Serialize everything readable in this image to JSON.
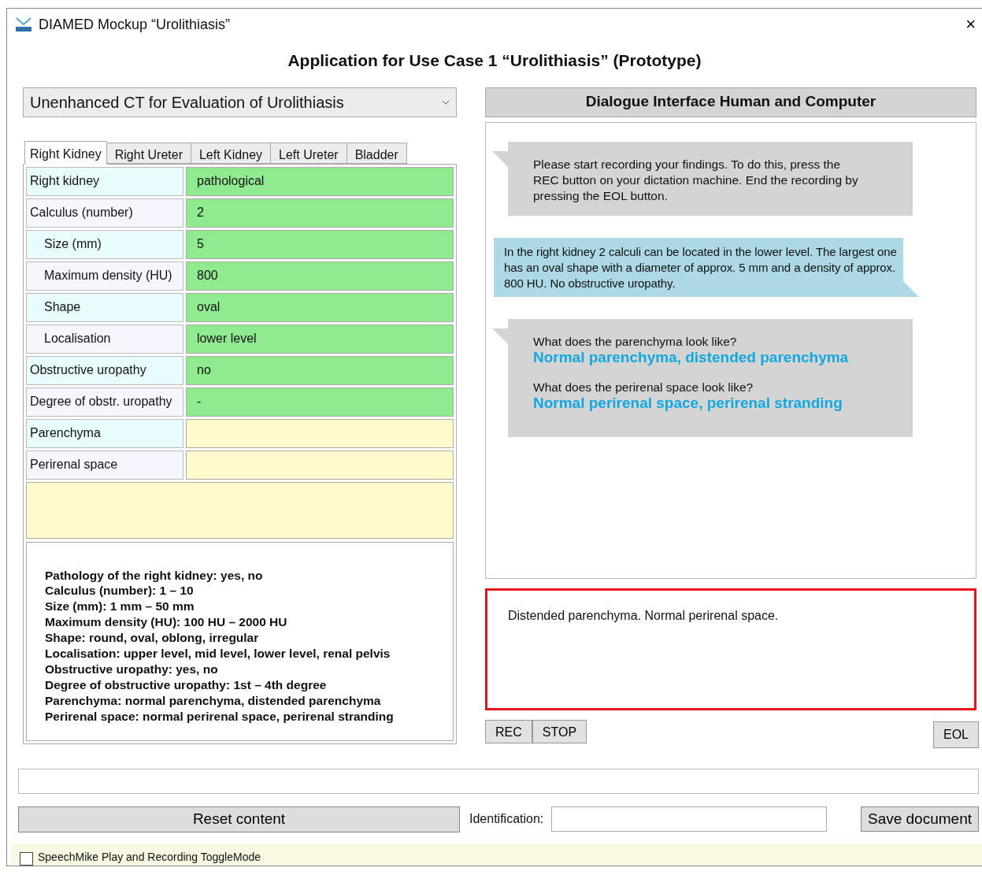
{
  "window": {
    "title": "DIAMED Mockup “Urolithiasis”",
    "close": "×"
  },
  "heading": "Application for Use Case 1 “Urolithiasis” (Prototype)",
  "protocol_select": {
    "value": "Unenhanced CT for Evaluation of Urolithiasis"
  },
  "tabs": [
    {
      "label": "Right Kidney",
      "selected": true
    },
    {
      "label": "Right Ureter",
      "selected": false
    },
    {
      "label": "Left Kidney",
      "selected": false
    },
    {
      "label": "Left Ureter",
      "selected": false
    },
    {
      "label": "Bladder",
      "selected": false
    }
  ],
  "findings": [
    {
      "label": "Right kidney",
      "value": "pathological",
      "indent": false,
      "filled": true
    },
    {
      "label": "Calculus (number)",
      "value": "2",
      "indent": false,
      "filled": true
    },
    {
      "label": "Size (mm)",
      "value": "5",
      "indent": true,
      "filled": true
    },
    {
      "label": "Maximum density (HU)",
      "value": "800",
      "indent": true,
      "filled": true
    },
    {
      "label": "Shape",
      "value": "oval",
      "indent": true,
      "filled": true
    },
    {
      "label": "Localisation",
      "value": "lower level",
      "indent": true,
      "filled": true
    },
    {
      "label": "Obstructive uropathy",
      "value": "no",
      "indent": false,
      "filled": true
    },
    {
      "label": "Degree of obstr. uropathy",
      "value": "-",
      "indent": false,
      "filled": true
    },
    {
      "label": "Parenchyma",
      "indent": false,
      "filled": false
    },
    {
      "label": "Perirenal space",
      "indent": false,
      "filled": false
    }
  ],
  "hints": [
    "Pathology of the right kidney: yes, no",
    "Calculus (number): 1 – 10",
    "Size (mm): 1 mm – 50 mm",
    "Maximum density (HU): 100 HU – 2000 HU",
    "Shape: round, oval, oblong, irregular",
    "Localisation: upper level, mid level, lower level, renal pelvis",
    "Obstructive uropathy: yes, no",
    "Degree of obstructive uropathy: 1st – 4th degree",
    "Parenchyma: normal parenchyma, distended parenchyma",
    "Perirenal space: normal perirenal space, perirenal stranding"
  ],
  "dialogue": {
    "title": "Dialogue Interface Human and Computer",
    "messages": [
      {
        "kind": "system",
        "parts": [
          {
            "kind": "text",
            "text": "Please start recording your findings. To do this, press the REC button on your dictation machine. End the recording by pressing the EOL button."
          }
        ]
      },
      {
        "kind": "user",
        "parts": [
          {
            "kind": "text",
            "text": "In the right kidney 2 calculi can be located in the lower level. The largest one has an oval shape with a diameter of approx. 5 mm and a density of approx. 800 HU. No obstructive uropathy."
          }
        ]
      },
      {
        "kind": "system",
        "parts": [
          {
            "kind": "question",
            "text": "What does the parenchyma look like?"
          },
          {
            "kind": "options",
            "text": "Normal parenchyma, distended parenchyma"
          },
          {
            "kind": "question",
            "text": "What does the perirenal space look like?"
          },
          {
            "kind": "options",
            "text": "Normal perirenal space, perirenal stranding"
          }
        ]
      }
    ]
  },
  "transcript": {
    "value": "Distended parenchyma. Normal perirenal space."
  },
  "recorder_buttons": [
    "REC",
    "STOP"
  ],
  "eol_button": "EOL",
  "reset_button": "Reset content",
  "identification": {
    "label": "Identification:"
  },
  "save_button": "Save document",
  "toggle": {
    "label": "SpeechMike Play and Recording ToggleMode",
    "checked": false
  }
}
